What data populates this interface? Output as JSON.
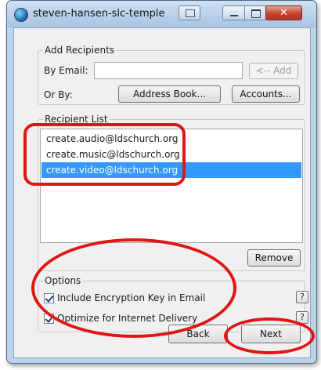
{
  "window": {
    "title": "steven-hansen-slc-temple"
  },
  "add_recipients": {
    "legend": "Add Recipients",
    "by_email_label": "By Email:",
    "email_value": "",
    "add_button": "<-- Add",
    "or_by_label": "Or By:",
    "address_book_button": "Address Book...",
    "accounts_button": "Accounts..."
  },
  "recipient_list": {
    "legend": "Recipient List",
    "items": [
      {
        "label": "create.audio@ldschurch.org",
        "selected": false
      },
      {
        "label": "create.music@ldschurch.org",
        "selected": false
      },
      {
        "label": "create.video@ldschurch.org",
        "selected": true
      }
    ],
    "remove_button": "Remove"
  },
  "options": {
    "legend": "Options",
    "include_key_label": "Include Encryption Key in Email",
    "include_key_checked": true,
    "optimize_label": "Optimize for Internet Delivery",
    "optimize_checked": true,
    "help_glyph": "?"
  },
  "footer": {
    "back_button": "Back",
    "next_button": "Next"
  },
  "annotation_color": "#e01515"
}
